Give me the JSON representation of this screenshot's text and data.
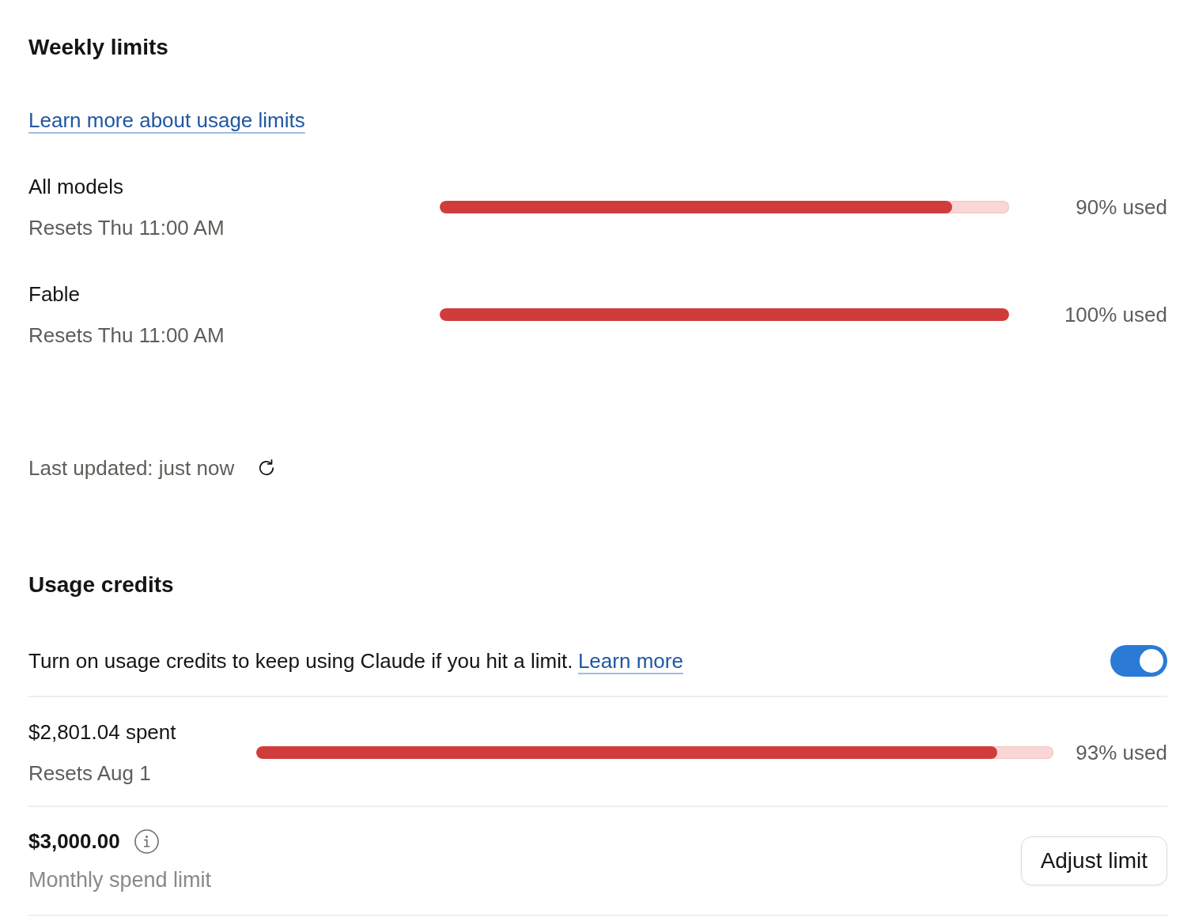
{
  "weekly_limits": {
    "title": "Weekly limits",
    "link": "Learn more about usage limits",
    "meters": [
      {
        "name": "All models",
        "resets": "Resets Thu 11:00 AM",
        "level": 0.9,
        "reading": "90% used"
      },
      {
        "name": "Fable",
        "resets": "Resets Thu 11:00 AM",
        "level": 1.0,
        "reading": "100% used"
      }
    ]
  },
  "last_updated": {
    "text": "Last updated: just now"
  },
  "usage_credits": {
    "title": "Usage credits",
    "description": "Turn on usage credits to keep using Claude if you hit a limit.",
    "link": "Learn more",
    "toggle": {
      "on": true
    },
    "spent": {
      "amount": "$2,801.04 spent",
      "resets": "Resets Aug 1",
      "level": 0.93,
      "reading": "93% used"
    },
    "limit": {
      "amount": "$3,000.00",
      "caption": "Monthly spend limit",
      "button": "Adjust limit"
    }
  }
}
